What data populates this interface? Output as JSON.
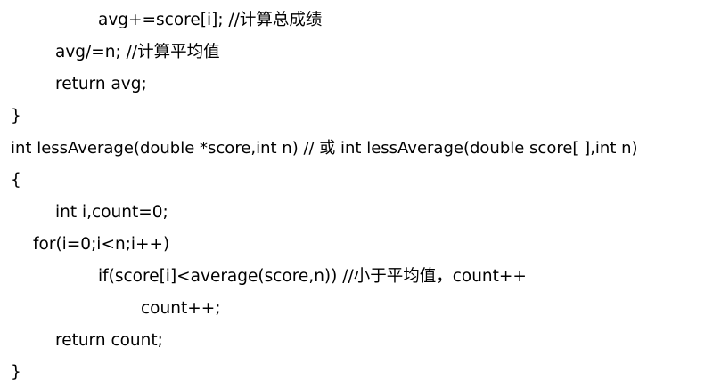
{
  "code_lines": [
    "avg+=score[i]; //计算总成绩",
    "avg/=n; //计算平均值",
    "return avg;",
    "}",
    "int lessAverage(double *score,int n) // 或 int lessAverage(double score[ ],int n)",
    "{",
    "int i,count=0;",
    "for(i=0;i<n;i++)",
    "if(score[i]<average(score,n)) //小于平均值，count++",
    "count++;",
    "return count;",
    "}"
  ]
}
